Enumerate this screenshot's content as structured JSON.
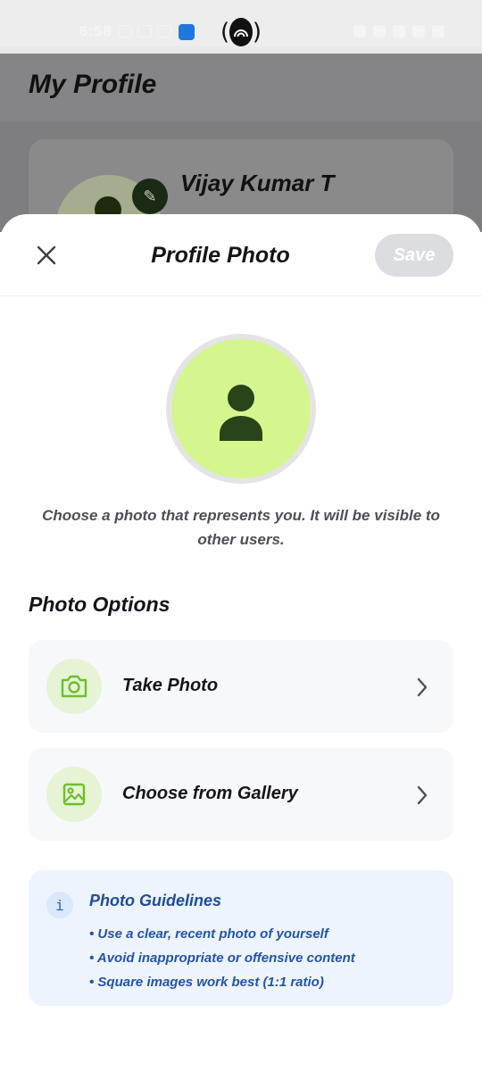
{
  "status_bar": {
    "time": "6:58"
  },
  "background_page": {
    "title": "My Profile",
    "user_name": "Vijay Kumar T"
  },
  "sheet": {
    "title": "Profile Photo",
    "save_label": "Save",
    "description": "Choose a photo that represents you. It will be visible to other users.",
    "section_title": "Photo Options",
    "options": [
      {
        "label": "Take Photo",
        "icon": "camera-icon"
      },
      {
        "label": "Choose from Gallery",
        "icon": "gallery-icon"
      }
    ],
    "guidelines": {
      "title": "Photo Guidelines",
      "items": [
        "• Use a clear, recent photo of yourself",
        "• Avoid inappropriate or offensive content",
        "• Square images work best (1:1 ratio)"
      ]
    }
  },
  "colors": {
    "avatar_bg": "#d5f58f",
    "avatar_figure": "#2b4318",
    "icon_green": "#6cbf2a",
    "guide_text": "#2553a8",
    "save_disabled": "#dcdde0"
  }
}
